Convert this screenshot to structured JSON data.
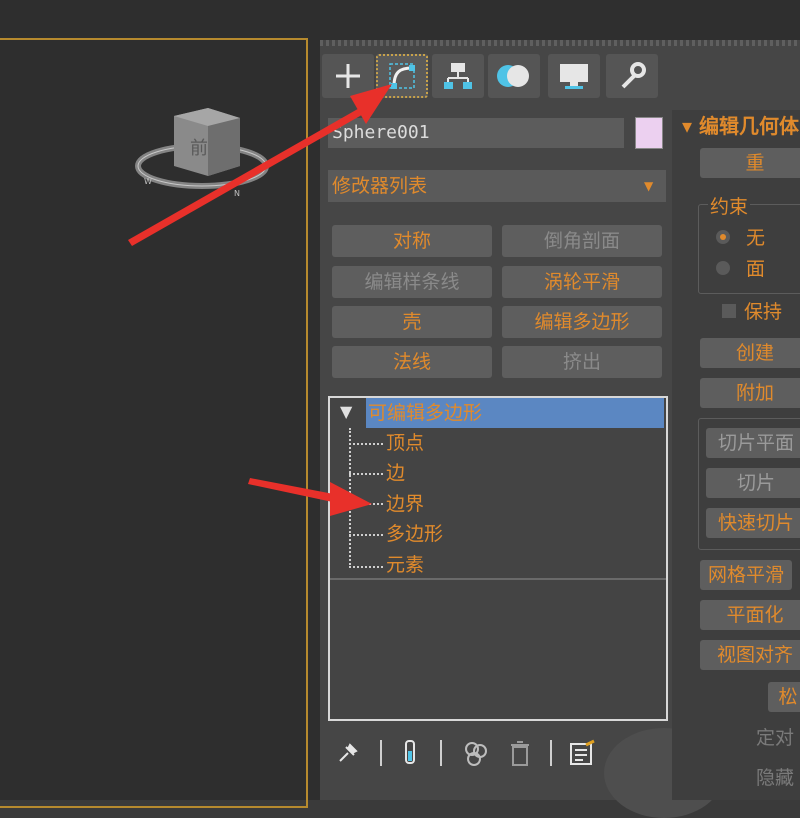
{
  "viewport": {
    "cube_label": "前"
  },
  "tabs": [
    {
      "name": "create",
      "icon": "plus-icon"
    },
    {
      "name": "modify",
      "icon": "modify-curve-icon",
      "active": true
    },
    {
      "name": "hierarchy",
      "icon": "hierarchy-icon"
    },
    {
      "name": "motion",
      "icon": "motion-icon"
    },
    {
      "name": "display",
      "icon": "monitor-icon"
    },
    {
      "name": "utilities",
      "icon": "wrench-icon"
    }
  ],
  "object": {
    "name": "Sphere001",
    "color": "#ecd0f0"
  },
  "modifier_list": {
    "label": "修改器列表"
  },
  "modifier_buttons": [
    {
      "label": "对称"
    },
    {
      "label": "倒角剖面"
    },
    {
      "label": "编辑样条线"
    },
    {
      "label": "涡轮平滑"
    },
    {
      "label": "壳"
    },
    {
      "label": "编辑多边形"
    },
    {
      "label": "法线"
    },
    {
      "label": "挤出"
    }
  ],
  "stack": {
    "title": "可编辑多边形",
    "items": [
      "顶点",
      "边",
      "边界",
      "多边形",
      "元素"
    ]
  },
  "bottom_toolbar": [
    "pin-icon",
    "show-end-result-icon",
    "make-unique-icon",
    "remove-modifier-icon",
    "configure-icon"
  ],
  "right_panel": {
    "title": "编辑几何体",
    "repeat_label": "重",
    "constraint": {
      "label": "约束",
      "options": [
        "无",
        "面"
      ],
      "selected": "无"
    },
    "preserve_label": "保持",
    "create_label": "创建",
    "attach_label": "附加",
    "slice_plane_label": "切片平面",
    "slice_label": "切片",
    "quick_slice_label": "快速切片",
    "mesh_smooth_label": "网格平滑",
    "planarize_label": "平面化",
    "view_align_label": "视图对齐",
    "relax_label": "松",
    "hide_selected_label": "定对",
    "hide_unselected_label": "隐藏"
  },
  "colors": {
    "accent": "#e08a2c",
    "selection": "#5b87c2",
    "frame": "#b68a2e",
    "arrow": "#e8302a"
  }
}
